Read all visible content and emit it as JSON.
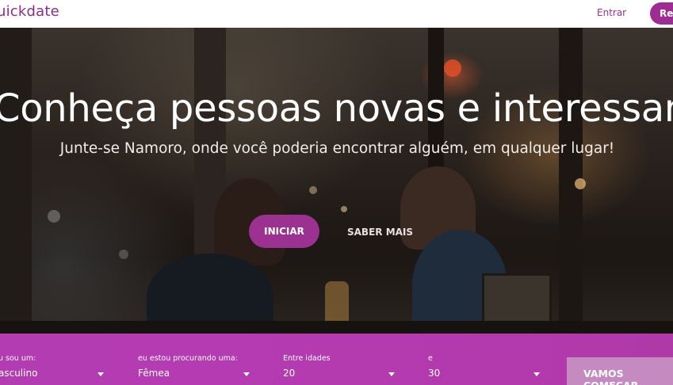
{
  "brand": {
    "logo_text": "uickdate"
  },
  "nav": {
    "login": "Entrar",
    "register": "Reg"
  },
  "hero": {
    "title": "Conheça pessoas novas e interessantes",
    "subtitle": "Junte-se Namoro, onde você poderia encontrar alguém, em qualquer lugar!",
    "start_button": "INICIAR",
    "more_button": "SABER MAIS"
  },
  "search": {
    "fields": [
      {
        "label": "u sou um:",
        "value": "asculino"
      },
      {
        "label": "eu estou procurando uma:",
        "value": "Fêmea"
      },
      {
        "label": "Entre idades",
        "value": "20"
      },
      {
        "label": "e",
        "value": "30"
      }
    ],
    "submit": "VAMOS COMEÇAR"
  },
  "colors": {
    "brand": "#9b2f95",
    "searchbar": "#b43cb3",
    "submit": "#c58bc1"
  }
}
